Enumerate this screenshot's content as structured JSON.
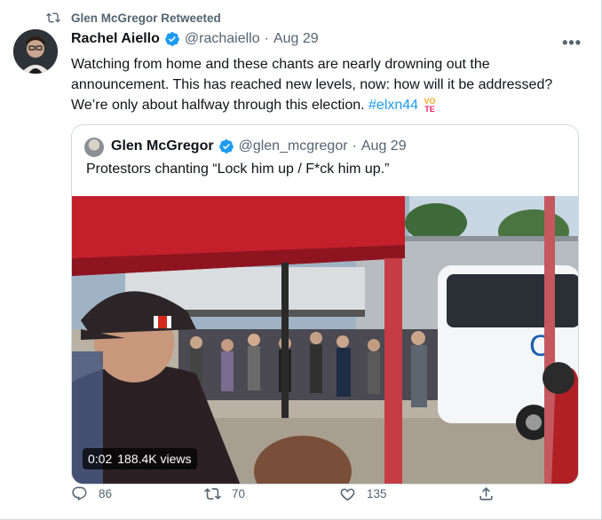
{
  "retweet_banner": "Glen McGregor Retweeted",
  "tweet": {
    "author_name": "Rachel Aiello",
    "handle": "@rachaiello",
    "separator": "·",
    "date": "Aug 29",
    "text_main": "Watching from home and these chants are nearly drowning out the announcement. This has reached new levels, now: how will it be addressed? We’re only about halfway through this election. ",
    "hashtag": "#elxn44",
    "vote_top": "VO",
    "vote_bottom": "TE"
  },
  "quoted": {
    "author_name": "Glen McGregor",
    "handle": "@glen_mcgregor",
    "separator": "·",
    "date": "Aug 29",
    "text": "Protestors chanting “Lock him up / F*ck him up.”",
    "video_time": "0:02",
    "video_views": "188.4K views"
  },
  "actions": {
    "replies": "86",
    "retweets": "70",
    "likes": "135"
  },
  "colors": {
    "accent": "#1d9bf0",
    "muted": "#536471",
    "border": "#cfd9de"
  },
  "icons": [
    "retweet-icon",
    "verified-badge-icon",
    "more-icon",
    "reply-icon",
    "like-icon",
    "share-icon"
  ]
}
